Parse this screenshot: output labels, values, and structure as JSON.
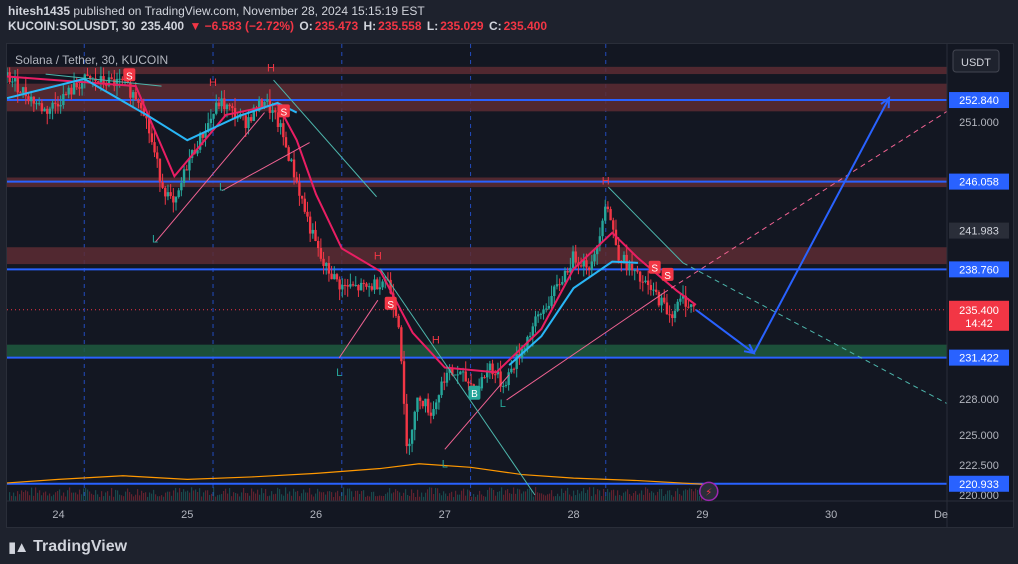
{
  "header": {
    "publisher": "hitesh1435",
    "published_text": "published on TradingView.com, November 28, 2024 15:15:19 EST",
    "symbol_line": "KUCOIN:SOLUSDT, 30",
    "last": "235.400",
    "change": "▼ −6.583 (−2.72%)",
    "o_label": "O:",
    "o": "235.473",
    "h_label": "H:",
    "h": "235.558",
    "l_label": "L:",
    "l": "235.029",
    "c_label": "C:",
    "c": "235.400"
  },
  "legend_title": "Solana / Tether, 30, KUCOIN",
  "currency": "USDT",
  "footer": {
    "brand": "TradingView"
  },
  "colors": {
    "background": "#131722",
    "up": "#26a69a",
    "down": "#f23645",
    "ema_fast": "#e91e63",
    "ema_slow": "#29b6f6",
    "level_line": "#2962ff",
    "resistance_zone": "#5d2b33",
    "support_zone": "#1e5a3e",
    "annotation_pink": "#f06292",
    "annotation_teal": "#4db6ac"
  },
  "chart_data": {
    "type": "candlestick",
    "title": "Solana / Tether, 30, KUCOIN",
    "xlabel": "",
    "ylabel": "",
    "x_ticks": [
      "24",
      "25",
      "26",
      "27",
      "28",
      "29",
      "30",
      "De"
    ],
    "x_range_days": [
      23.6,
      30.9
    ],
    "y_ticks": [
      220.0,
      222.5,
      225.0,
      228.0,
      231.422,
      235.4,
      238.76,
      241.983,
      246.058,
      251.0,
      252.84
    ],
    "y_tick_labels": [
      "220.000",
      "222.500",
      "225.000",
      "228.000",
      "231.422",
      "235.400",
      "238.760",
      "241.983",
      "246.058",
      "251.000",
      "252.840"
    ],
    "ylim": [
      219.5,
      257.5
    ],
    "grid": false,
    "levels": [
      {
        "value": 252.84,
        "label": "252.840"
      },
      {
        "value": 246.058,
        "label": "246.058"
      },
      {
        "value": 238.76,
        "label": "238.760"
      },
      {
        "value": 231.422,
        "label": "231.422"
      },
      {
        "value": 220.933,
        "label": "220.933"
      }
    ],
    "zones": [
      {
        "kind": "resistance",
        "from": 255.0,
        "to": 255.6
      },
      {
        "kind": "resistance",
        "from": 251.9,
        "to": 254.2
      },
      {
        "kind": "resistance",
        "from": 245.6,
        "to": 246.4
      },
      {
        "kind": "resistance",
        "from": 239.2,
        "to": 240.6
      },
      {
        "kind": "support",
        "from": 231.5,
        "to": 232.5
      }
    ],
    "last_price": {
      "value": 235.4,
      "label": "235.400",
      "countdown": "14:42"
    },
    "close_path": [
      [
        23.6,
        254.8
      ],
      [
        23.9,
        251.9
      ],
      [
        24.2,
        254.5
      ],
      [
        24.5,
        254.2
      ],
      [
        24.65,
        252.6
      ],
      [
        24.8,
        246.0
      ],
      [
        24.9,
        243.8
      ],
      [
        25.0,
        247.6
      ],
      [
        25.15,
        250.6
      ],
      [
        25.25,
        252.7
      ],
      [
        25.45,
        251.0
      ],
      [
        25.6,
        252.9
      ],
      [
        25.72,
        250.6
      ],
      [
        25.85,
        246.0
      ],
      [
        25.95,
        242.3
      ],
      [
        26.05,
        239.2
      ],
      [
        26.2,
        237.3
      ],
      [
        26.4,
        237.2
      ],
      [
        26.55,
        238.1
      ],
      [
        26.65,
        234.1
      ],
      [
        26.7,
        223.6
      ],
      [
        26.8,
        228.3
      ],
      [
        26.9,
        226.8
      ],
      [
        27.0,
        230.0
      ],
      [
        27.1,
        230.1
      ],
      [
        27.25,
        228.8
      ],
      [
        27.35,
        230.8
      ],
      [
        27.45,
        229.1
      ],
      [
        27.55,
        231.1
      ],
      [
        27.7,
        234.3
      ],
      [
        27.85,
        236.8
      ],
      [
        28.0,
        239.8
      ],
      [
        28.15,
        239.0
      ],
      [
        28.25,
        244.6
      ],
      [
        28.35,
        240.0
      ],
      [
        28.5,
        238.0
      ],
      [
        28.65,
        236.5
      ],
      [
        28.75,
        235.0
      ],
      [
        28.85,
        236.3
      ],
      [
        28.95,
        235.4
      ]
    ],
    "series": [
      {
        "name": "",
        "kind": "ema_fast",
        "points": [
          [
            23.6,
            254.8
          ],
          [
            24.6,
            254.0
          ],
          [
            24.9,
            246.5
          ],
          [
            25.3,
            251.6
          ],
          [
            25.7,
            252.5
          ],
          [
            25.85,
            249.5
          ],
          [
            26.0,
            245.0
          ],
          [
            26.2,
            240.5
          ],
          [
            26.5,
            238.6
          ],
          [
            26.75,
            233.5
          ],
          [
            27.0,
            230.6
          ],
          [
            27.4,
            230.2
          ],
          [
            27.75,
            233.8
          ],
          [
            28.0,
            238.8
          ],
          [
            28.3,
            241.8
          ],
          [
            28.5,
            239.7
          ],
          [
            28.8,
            237.0
          ],
          [
            28.95,
            235.8
          ]
        ]
      },
      {
        "name": "",
        "kind": "ema_slow",
        "points": [
          [
            23.6,
            253.0
          ],
          [
            24.2,
            254.6
          ],
          [
            24.7,
            251.5
          ],
          [
            25.0,
            249.5
          ],
          [
            25.4,
            251.5
          ],
          [
            25.7,
            252.6
          ],
          [
            25.85,
            251.8
          ]
        ]
      },
      {
        "name": "",
        "kind": "ema_slow",
        "points": [
          [
            27.5,
            230.8
          ],
          [
            27.75,
            233.2
          ],
          [
            28.0,
            237.2
          ],
          [
            28.3,
            239.4
          ],
          [
            28.5,
            239.3
          ]
        ]
      }
    ],
    "projection": [
      [
        28.95,
        235.4
      ],
      [
        29.4,
        231.8
      ],
      [
        30.45,
        253.0
      ]
    ],
    "annotations": {
      "H": [
        [
          25.65,
          255.2
        ],
        [
          25.2,
          254.0
        ],
        [
          26.48,
          239.6
        ],
        [
          26.93,
          232.6
        ],
        [
          28.25,
          245.8
        ]
      ],
      "L": [
        [
          24.75,
          241.0
        ],
        [
          25.27,
          245.3
        ],
        [
          26.18,
          229.9
        ],
        [
          27.0,
          222.3
        ],
        [
          27.45,
          227.3
        ]
      ],
      "S": [
        [
          24.55,
          254.9
        ],
        [
          25.75,
          251.9
        ],
        [
          26.58,
          235.9
        ],
        [
          28.63,
          238.9
        ],
        [
          28.73,
          238.3
        ]
      ],
      "B": [
        [
          27.23,
          228.5
        ]
      ]
    },
    "trendlines_pink": [
      [
        [
          24.75,
          241.0
        ],
        [
          25.6,
          251.8
        ]
      ],
      [
        [
          25.27,
          245.3
        ],
        [
          25.95,
          249.3
        ]
      ],
      [
        [
          26.18,
          231.4
        ],
        [
          26.48,
          236.2
        ]
      ],
      [
        [
          27.0,
          223.8
        ],
        [
          27.5,
          230.0
        ]
      ],
      [
        [
          27.48,
          227.9
        ],
        [
          28.7,
          236.8
        ]
      ]
    ],
    "trendlines_pink_dashed": [
      [
        [
          28.7,
          236.8
        ],
        [
          30.9,
          251.9
        ]
      ]
    ],
    "trendlines_teal": [
      [
        [
          23.9,
          255.0
        ],
        [
          24.8,
          254.0
        ]
      ],
      [
        [
          25.67,
          254.5
        ],
        [
          26.47,
          244.8
        ]
      ],
      [
        [
          26.5,
          238.8
        ],
        [
          27.7,
          220.0
        ]
      ],
      [
        [
          28.27,
          245.6
        ],
        [
          28.85,
          239.3
        ]
      ]
    ],
    "trendlines_teal_dashed": [
      [
        [
          28.85,
          239.3
        ],
        [
          30.9,
          227.6
        ]
      ]
    ],
    "volume_line": [
      [
        23.6,
        221.0
      ],
      [
        24.0,
        221.3
      ],
      [
        24.5,
        221.6
      ],
      [
        25.0,
        221.3
      ],
      [
        25.5,
        221.5
      ],
      [
        26.0,
        221.8
      ],
      [
        26.5,
        222.2
      ],
      [
        26.8,
        222.6
      ],
      [
        27.2,
        222.3
      ],
      [
        27.6,
        221.7
      ],
      [
        28.0,
        221.4
      ],
      [
        28.5,
        221.2
      ],
      [
        29.0,
        220.9
      ]
    ],
    "vertical_markers_days": [
      24.2,
      25.2,
      26.2,
      27.2,
      28.25
    ]
  }
}
